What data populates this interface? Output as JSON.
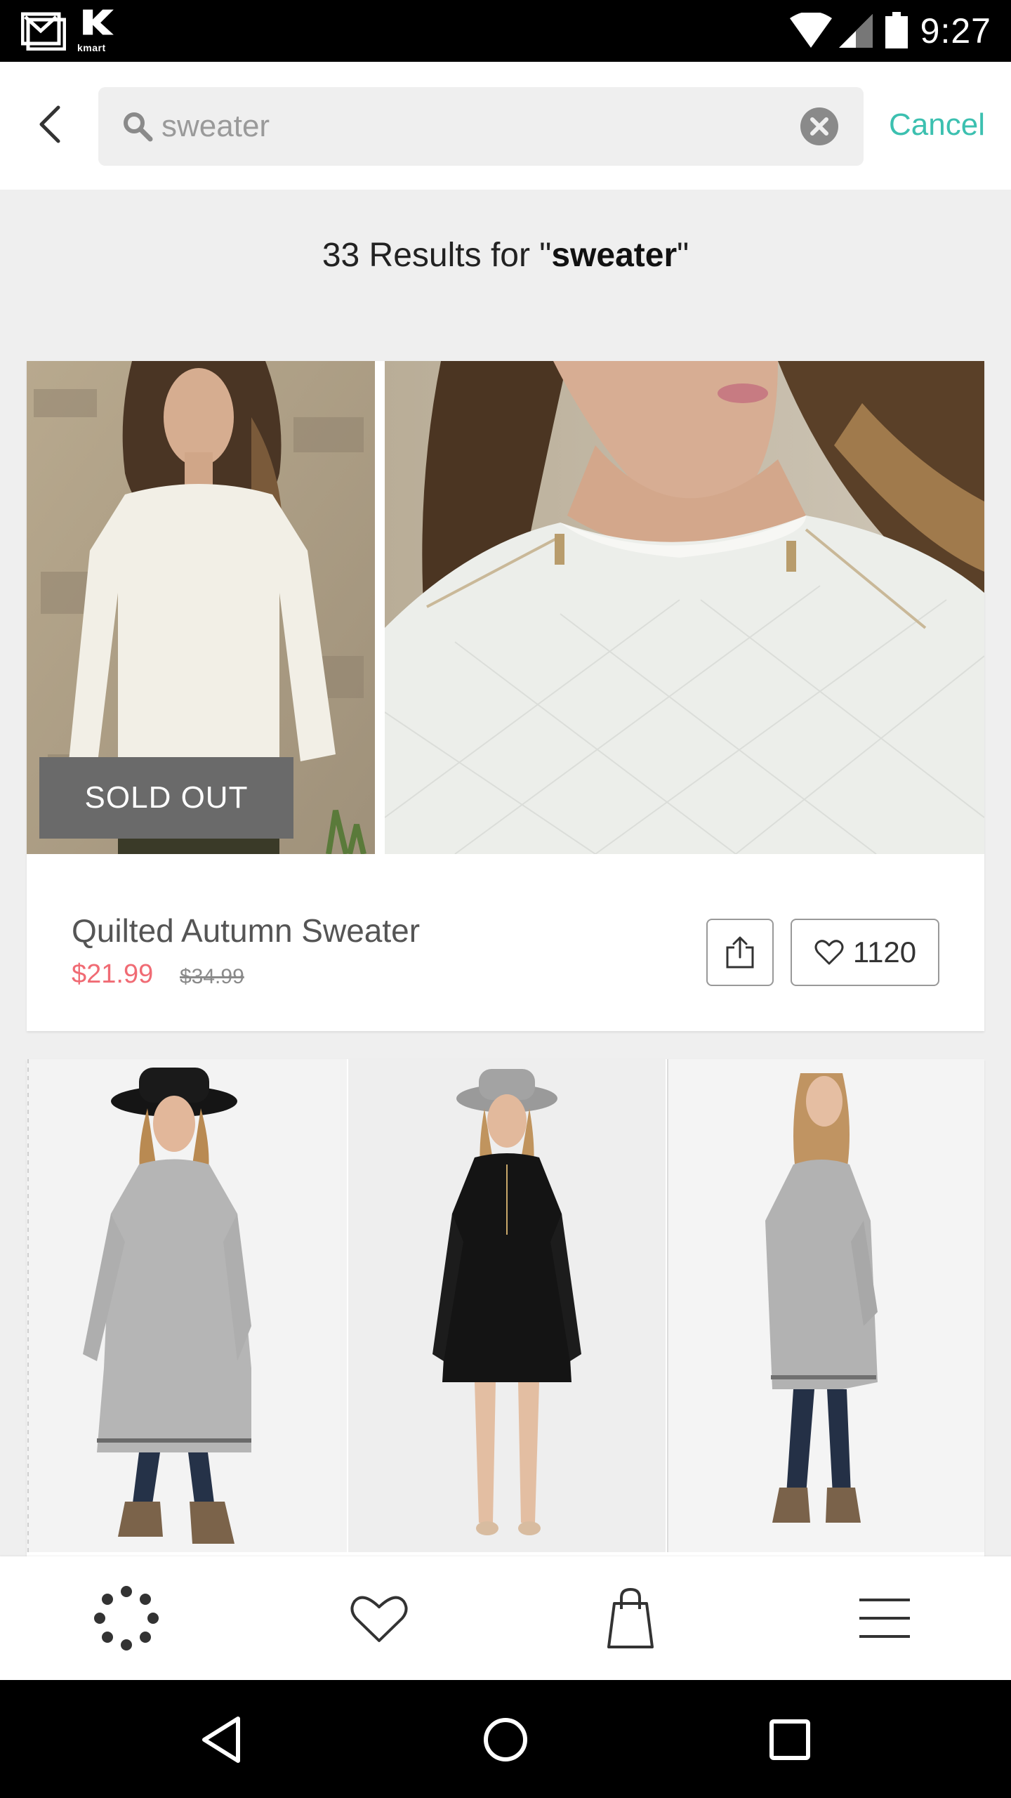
{
  "status_bar": {
    "carrier_label": "kmart",
    "time": "9:27",
    "icons": [
      "gmail-icon",
      "kmart-icon",
      "wifi-icon",
      "signal-icon",
      "battery-icon"
    ]
  },
  "search": {
    "back_icon": "chevron-left-icon",
    "placeholder": "Search",
    "query": "sweater",
    "cancel_label": "Cancel"
  },
  "results": {
    "count_text": "33 Results for \"",
    "query": "sweater",
    "close_text": "\""
  },
  "products": [
    {
      "name": "Quilted Autumn Sweater",
      "badge": "SOLD OUT",
      "sale_price": "$21.99",
      "original_price": "$34.99",
      "likes": "1120",
      "images": [
        "woman-white-quilted-sweater-full",
        "woman-white-quilted-sweater-closeup"
      ]
    },
    {
      "images": [
        "woman-gray-sweater-dress-black-hat",
        "woman-black-sweater-dress-gray-hat",
        "woman-gray-sweater-dress-side"
      ]
    }
  ],
  "bottom_tabs": [
    {
      "icon": "discover-dots-icon"
    },
    {
      "icon": "heart-icon"
    },
    {
      "icon": "shopping-bag-icon"
    },
    {
      "icon": "menu-icon"
    }
  ],
  "system_nav": [
    {
      "icon": "nav-back-icon"
    },
    {
      "icon": "nav-home-icon"
    },
    {
      "icon": "nav-recents-icon"
    }
  ],
  "colors": {
    "accent": "#3cc0b0",
    "sale_price": "#f06b74",
    "badge_bg": "#6a6a6a",
    "page_bg": "#efefef"
  }
}
